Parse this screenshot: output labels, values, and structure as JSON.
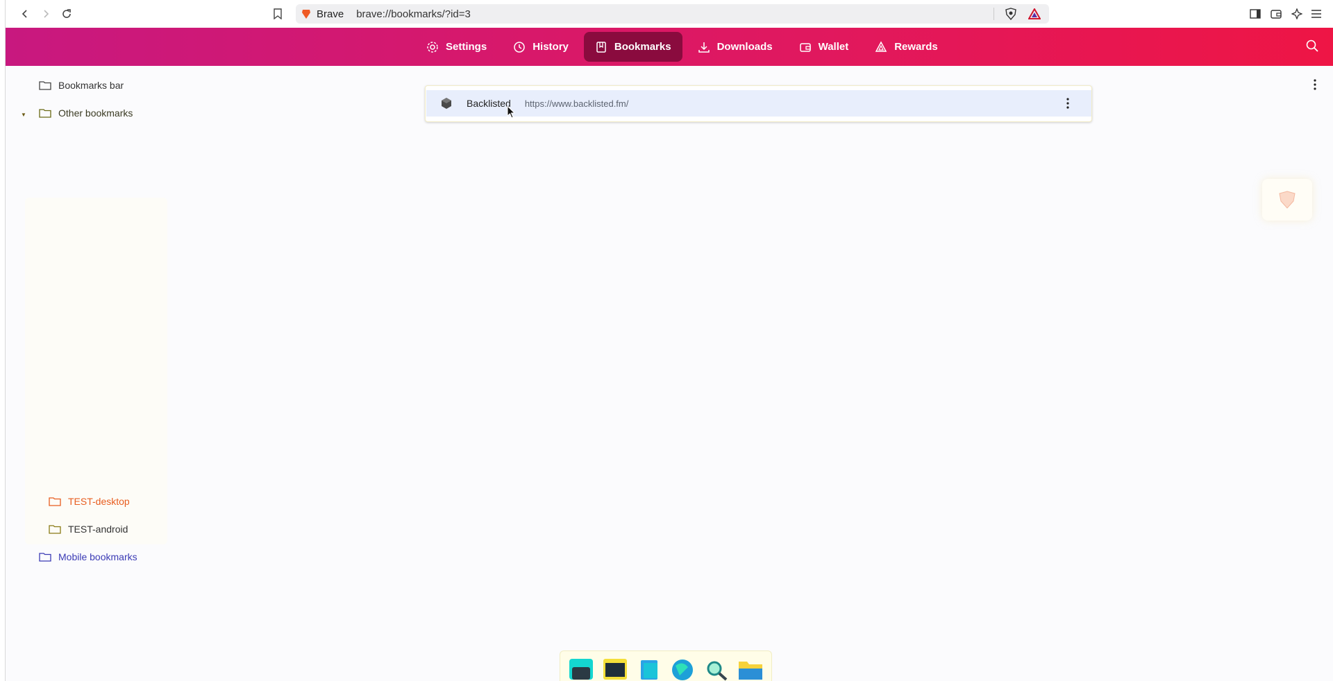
{
  "browser": {
    "brand": "Brave",
    "url": "brave://bookmarks/?id=3"
  },
  "header": {
    "tabs": [
      {
        "label": "Settings",
        "icon": "gear-icon"
      },
      {
        "label": "History",
        "icon": "history-icon"
      },
      {
        "label": "Bookmarks",
        "icon": "bookmark-book-icon",
        "active": true
      },
      {
        "label": "Downloads",
        "icon": "download-icon"
      },
      {
        "label": "Wallet",
        "icon": "wallet-icon"
      },
      {
        "label": "Rewards",
        "icon": "rewards-triangle-icon"
      }
    ]
  },
  "sidebar": {
    "items": [
      {
        "label": "Bookmarks bar"
      },
      {
        "label": "Other bookmarks",
        "expanded": true
      },
      {
        "label": "TEST-desktop",
        "color": "#e85d1f"
      },
      {
        "label": "TEST-android"
      },
      {
        "label": "Mobile bookmarks",
        "color": "#3b3bb5"
      }
    ]
  },
  "list": {
    "items": [
      {
        "title": "Backlisted",
        "url": "https://www.backlisted.fm/"
      }
    ]
  },
  "colors": {
    "header_start": "#c8187f",
    "header_end": "#ee1545",
    "active_tab": "#8a0b3e",
    "selected_row": "#e8eefc"
  },
  "dock": {
    "icons": [
      "terminal-icon",
      "screen-icon",
      "files-icon",
      "globe-icon",
      "search-magnifier-icon",
      "folder-icon"
    ]
  }
}
